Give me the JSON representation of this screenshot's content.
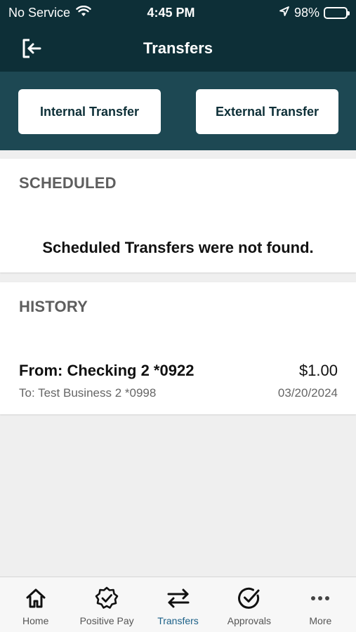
{
  "status_bar": {
    "carrier": "No Service",
    "time": "4:45 PM",
    "battery": "98%"
  },
  "header": {
    "title": "Transfers"
  },
  "transfer_buttons": {
    "internal": "Internal Transfer",
    "external": "External Transfer"
  },
  "scheduled": {
    "title": "SCHEDULED",
    "empty_message": "Scheduled Transfers were not found."
  },
  "history": {
    "title": "HISTORY",
    "items": [
      {
        "from": "From: Checking 2 *0922",
        "to": "To: Test Business 2 *0998",
        "amount": "$1.00",
        "date": "03/20/2024"
      }
    ]
  },
  "tabs": [
    {
      "label": "Home",
      "icon": "home-icon",
      "active": false
    },
    {
      "label": "Positive Pay",
      "icon": "badge-check-icon",
      "active": false
    },
    {
      "label": "Transfers",
      "icon": "transfer-arrows-icon",
      "active": true
    },
    {
      "label": "Approvals",
      "icon": "check-circle-icon",
      "active": false
    },
    {
      "label": "More",
      "icon": "more-dots-icon",
      "active": false
    }
  ],
  "colors": {
    "header_bg": "#0d2f37",
    "band_bg": "#1d4853",
    "active_tab": "#1a5f87"
  }
}
